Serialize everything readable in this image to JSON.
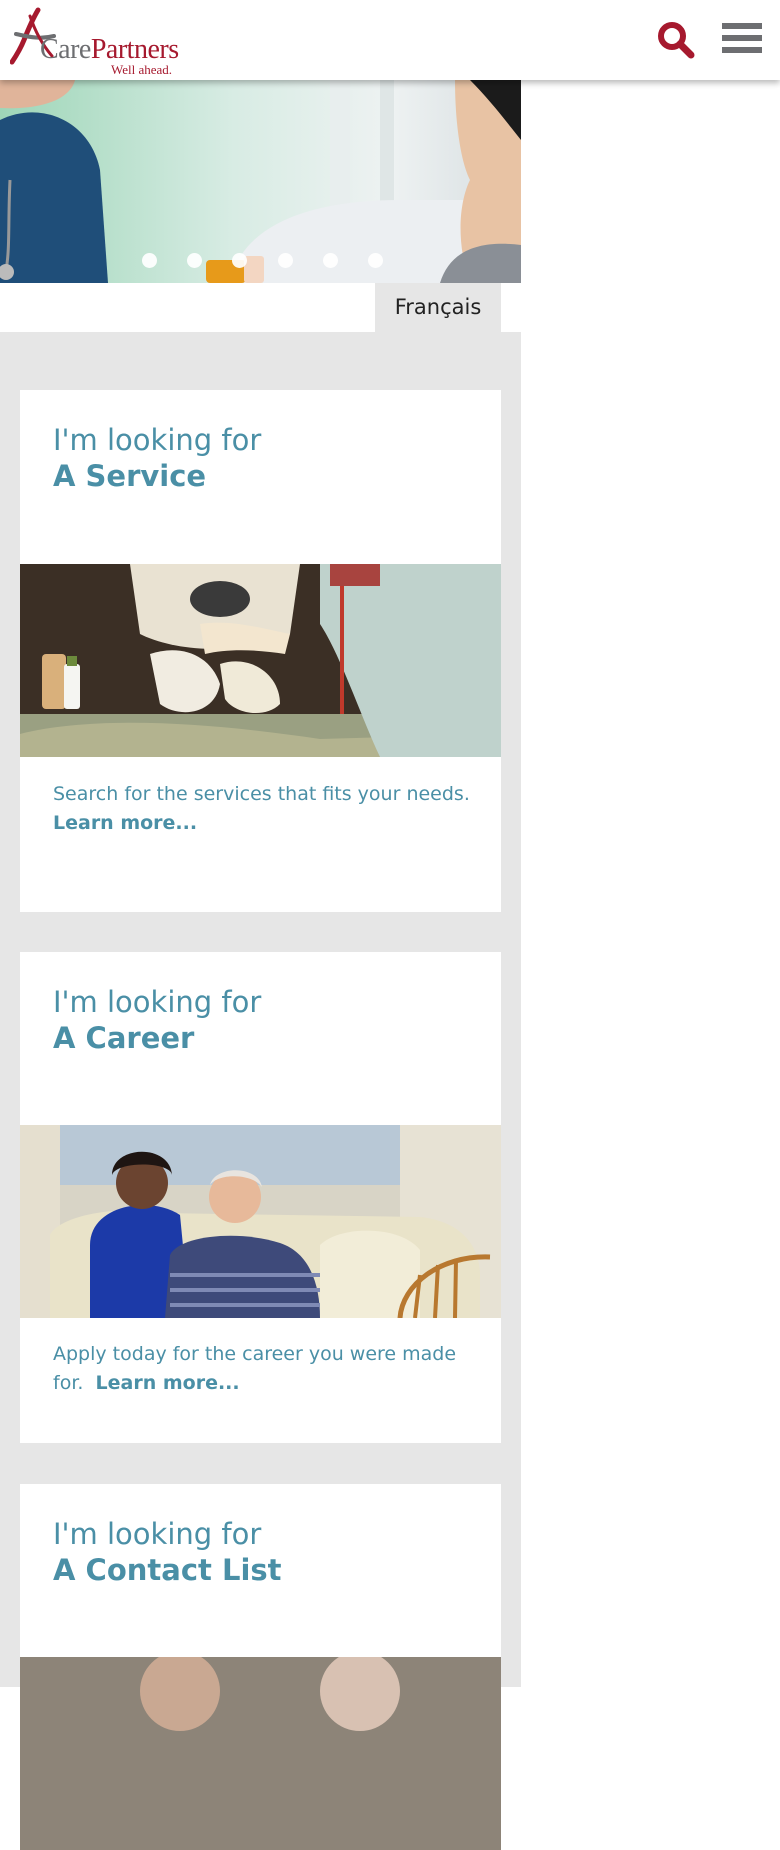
{
  "header": {
    "logo": {
      "word_care": "Care",
      "word_partners": "Partners",
      "tagline": "Well ahead."
    },
    "search_icon": "search-icon",
    "menu_icon": "hamburger-menu-icon",
    "brand_color": "#a6192e"
  },
  "hero": {
    "slide_count": 6,
    "active_slide": 3
  },
  "language": {
    "label": "Français"
  },
  "cards": [
    {
      "pre": "I'm looking for",
      "title": "A Service",
      "text": "Search for the services that fits your needs.",
      "link": "Learn more..."
    },
    {
      "pre": "I'm looking for",
      "title": "A Career",
      "text": "Apply today for the career you were made for.",
      "link": "Learn more..."
    },
    {
      "pre": "I'm looking for",
      "title": "A Contact List"
    }
  ],
  "colors": {
    "accent_text": "#4a8fa6",
    "panel_gray": "#e6e6e6",
    "logo_gray": "#6d6e71"
  }
}
